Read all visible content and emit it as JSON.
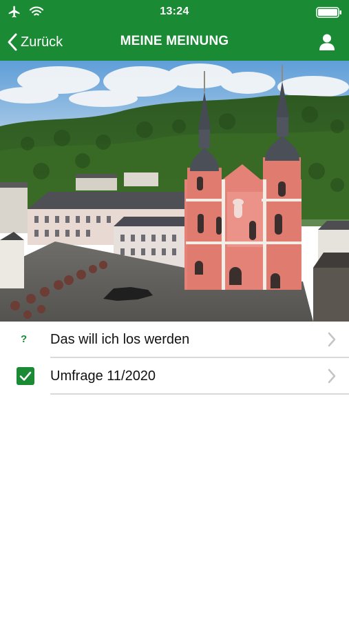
{
  "status_bar": {
    "time": "13:24",
    "icons": [
      "airplane-icon",
      "wifi-icon",
      "battery-icon"
    ]
  },
  "nav": {
    "back_label": "Zurück",
    "title": "MEINE MEINUNG",
    "back_icon": "chevron-left-icon",
    "profile_icon": "user-icon"
  },
  "hero": {
    "subject": "church-photo"
  },
  "list": {
    "items": [
      {
        "label": "Das will ich los werden",
        "icon": "question-mark-icon"
      },
      {
        "label": "Umfrage 11/2020",
        "icon": "checkbox-checked-icon"
      }
    ]
  },
  "colors": {
    "brand_green": "#1b8a34",
    "divider": "#d9d9d9",
    "chevron": "#c4c4c4"
  }
}
